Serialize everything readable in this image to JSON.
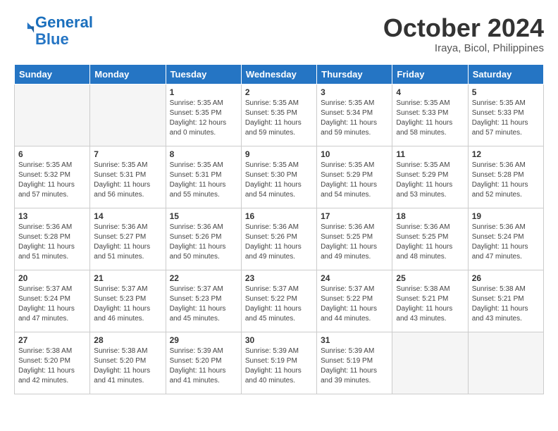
{
  "header": {
    "logo_line1": "General",
    "logo_line2": "Blue",
    "month": "October 2024",
    "location": "Iraya, Bicol, Philippines"
  },
  "days_of_week": [
    "Sunday",
    "Monday",
    "Tuesday",
    "Wednesday",
    "Thursday",
    "Friday",
    "Saturday"
  ],
  "weeks": [
    [
      {
        "day": "",
        "info": ""
      },
      {
        "day": "",
        "info": ""
      },
      {
        "day": "1",
        "info": "Sunrise: 5:35 AM\nSunset: 5:35 PM\nDaylight: 12 hours\nand 0 minutes."
      },
      {
        "day": "2",
        "info": "Sunrise: 5:35 AM\nSunset: 5:35 PM\nDaylight: 11 hours\nand 59 minutes."
      },
      {
        "day": "3",
        "info": "Sunrise: 5:35 AM\nSunset: 5:34 PM\nDaylight: 11 hours\nand 59 minutes."
      },
      {
        "day": "4",
        "info": "Sunrise: 5:35 AM\nSunset: 5:33 PM\nDaylight: 11 hours\nand 58 minutes."
      },
      {
        "day": "5",
        "info": "Sunrise: 5:35 AM\nSunset: 5:33 PM\nDaylight: 11 hours\nand 57 minutes."
      }
    ],
    [
      {
        "day": "6",
        "info": "Sunrise: 5:35 AM\nSunset: 5:32 PM\nDaylight: 11 hours\nand 57 minutes."
      },
      {
        "day": "7",
        "info": "Sunrise: 5:35 AM\nSunset: 5:31 PM\nDaylight: 11 hours\nand 56 minutes."
      },
      {
        "day": "8",
        "info": "Sunrise: 5:35 AM\nSunset: 5:31 PM\nDaylight: 11 hours\nand 55 minutes."
      },
      {
        "day": "9",
        "info": "Sunrise: 5:35 AM\nSunset: 5:30 PM\nDaylight: 11 hours\nand 54 minutes."
      },
      {
        "day": "10",
        "info": "Sunrise: 5:35 AM\nSunset: 5:29 PM\nDaylight: 11 hours\nand 54 minutes."
      },
      {
        "day": "11",
        "info": "Sunrise: 5:35 AM\nSunset: 5:29 PM\nDaylight: 11 hours\nand 53 minutes."
      },
      {
        "day": "12",
        "info": "Sunrise: 5:36 AM\nSunset: 5:28 PM\nDaylight: 11 hours\nand 52 minutes."
      }
    ],
    [
      {
        "day": "13",
        "info": "Sunrise: 5:36 AM\nSunset: 5:28 PM\nDaylight: 11 hours\nand 51 minutes."
      },
      {
        "day": "14",
        "info": "Sunrise: 5:36 AM\nSunset: 5:27 PM\nDaylight: 11 hours\nand 51 minutes."
      },
      {
        "day": "15",
        "info": "Sunrise: 5:36 AM\nSunset: 5:26 PM\nDaylight: 11 hours\nand 50 minutes."
      },
      {
        "day": "16",
        "info": "Sunrise: 5:36 AM\nSunset: 5:26 PM\nDaylight: 11 hours\nand 49 minutes."
      },
      {
        "day": "17",
        "info": "Sunrise: 5:36 AM\nSunset: 5:25 PM\nDaylight: 11 hours\nand 49 minutes."
      },
      {
        "day": "18",
        "info": "Sunrise: 5:36 AM\nSunset: 5:25 PM\nDaylight: 11 hours\nand 48 minutes."
      },
      {
        "day": "19",
        "info": "Sunrise: 5:36 AM\nSunset: 5:24 PM\nDaylight: 11 hours\nand 47 minutes."
      }
    ],
    [
      {
        "day": "20",
        "info": "Sunrise: 5:37 AM\nSunset: 5:24 PM\nDaylight: 11 hours\nand 47 minutes."
      },
      {
        "day": "21",
        "info": "Sunrise: 5:37 AM\nSunset: 5:23 PM\nDaylight: 11 hours\nand 46 minutes."
      },
      {
        "day": "22",
        "info": "Sunrise: 5:37 AM\nSunset: 5:23 PM\nDaylight: 11 hours\nand 45 minutes."
      },
      {
        "day": "23",
        "info": "Sunrise: 5:37 AM\nSunset: 5:22 PM\nDaylight: 11 hours\nand 45 minutes."
      },
      {
        "day": "24",
        "info": "Sunrise: 5:37 AM\nSunset: 5:22 PM\nDaylight: 11 hours\nand 44 minutes."
      },
      {
        "day": "25",
        "info": "Sunrise: 5:38 AM\nSunset: 5:21 PM\nDaylight: 11 hours\nand 43 minutes."
      },
      {
        "day": "26",
        "info": "Sunrise: 5:38 AM\nSunset: 5:21 PM\nDaylight: 11 hours\nand 43 minutes."
      }
    ],
    [
      {
        "day": "27",
        "info": "Sunrise: 5:38 AM\nSunset: 5:20 PM\nDaylight: 11 hours\nand 42 minutes."
      },
      {
        "day": "28",
        "info": "Sunrise: 5:38 AM\nSunset: 5:20 PM\nDaylight: 11 hours\nand 41 minutes."
      },
      {
        "day": "29",
        "info": "Sunrise: 5:39 AM\nSunset: 5:20 PM\nDaylight: 11 hours\nand 41 minutes."
      },
      {
        "day": "30",
        "info": "Sunrise: 5:39 AM\nSunset: 5:19 PM\nDaylight: 11 hours\nand 40 minutes."
      },
      {
        "day": "31",
        "info": "Sunrise: 5:39 AM\nSunset: 5:19 PM\nDaylight: 11 hours\nand 39 minutes."
      },
      {
        "day": "",
        "info": ""
      },
      {
        "day": "",
        "info": ""
      }
    ]
  ]
}
